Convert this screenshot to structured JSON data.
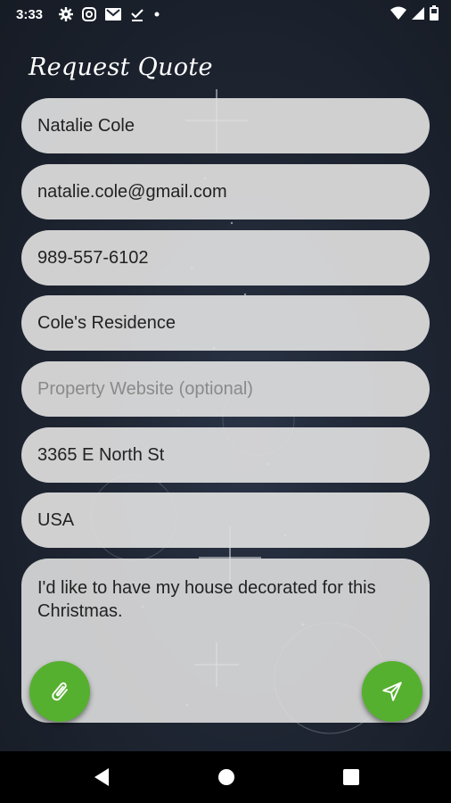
{
  "status_bar": {
    "time": "3:33",
    "left_icons": [
      "settings-icon",
      "instagram-icon",
      "gmail-icon",
      "download-done-icon",
      "dot-icon"
    ],
    "right_icons": [
      "wifi-icon",
      "signal-icon",
      "battery-icon"
    ]
  },
  "screen": {
    "title": "Request Quote"
  },
  "form": {
    "name": {
      "value": "Natalie Cole"
    },
    "email": {
      "value": "natalie.cole@gmail.com"
    },
    "phone": {
      "value": "989-557-6102"
    },
    "property_name": {
      "value": "Cole's Residence"
    },
    "website": {
      "placeholder": "Property Website (optional)"
    },
    "address": {
      "value": "3365 E North St"
    },
    "country": {
      "value": "USA"
    },
    "message": {
      "value": "I'd like to have my house decorated for this Christmas."
    }
  },
  "actions": {
    "attach_icon": "paperclip-icon",
    "send_icon": "send-icon"
  },
  "colors": {
    "accent": "#56b02f",
    "field_bg": "#dedede",
    "background": "#1f2633"
  },
  "nav_bar": {
    "buttons": [
      "back-icon",
      "home-icon",
      "recents-icon"
    ]
  }
}
